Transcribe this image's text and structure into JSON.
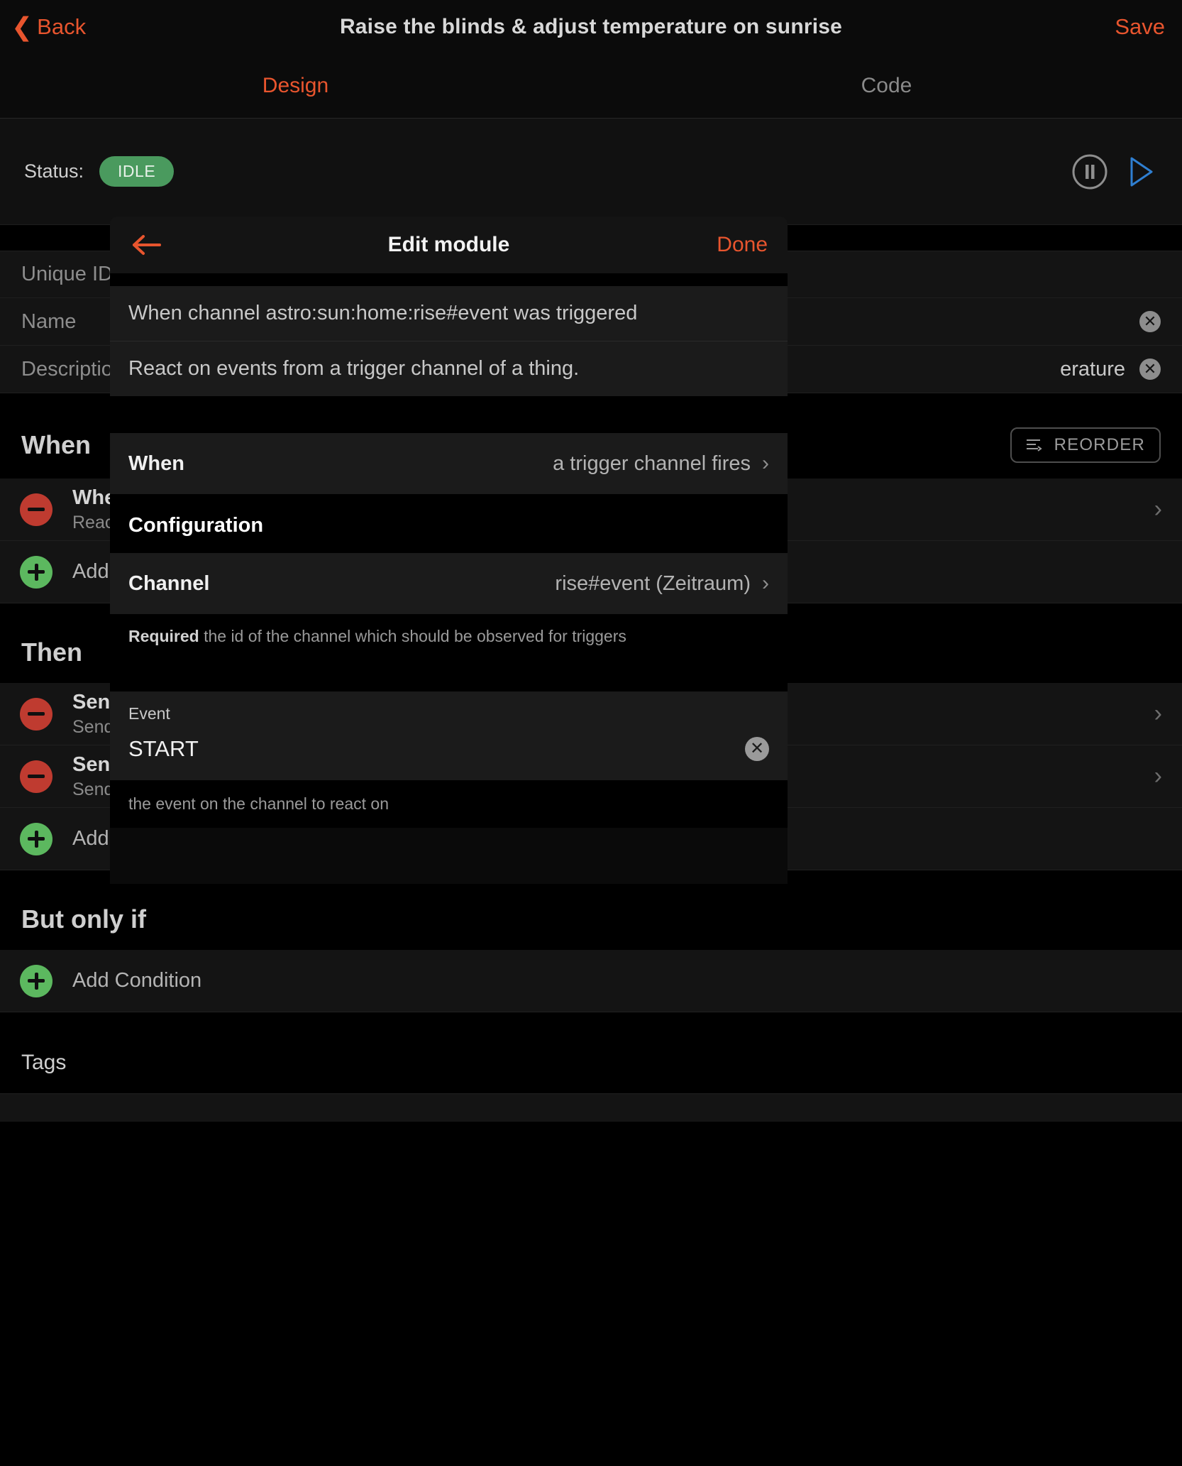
{
  "navbar": {
    "back_label": "Back",
    "title": "Raise the blinds & adjust temperature on sunrise",
    "save_label": "Save"
  },
  "tabs": [
    {
      "label": "Design",
      "state": "active"
    },
    {
      "label": "Code",
      "state": "inactive"
    }
  ],
  "status": {
    "label": "Status:",
    "badge": "IDLE",
    "badge_color": "#4a9a5e",
    "pause_icon": "pause-circle-icon",
    "play_icon": "play-icon"
  },
  "form": {
    "rows": [
      {
        "label": "Unique ID",
        "value": "",
        "has_clear": false
      },
      {
        "label": "Name",
        "value": "",
        "has_clear": true
      },
      {
        "label": "Description",
        "value": "erature",
        "has_clear": true
      }
    ]
  },
  "sections": {
    "when": {
      "title": "When",
      "reorder_label": "REORDER",
      "rows": [
        {
          "type": "remove",
          "title": "When",
          "sub": "React o",
          "chevron": "›"
        },
        {
          "type": "add",
          "title": "Add Tr"
        }
      ]
    },
    "then": {
      "title": "Then",
      "rows": [
        {
          "type": "remove",
          "title": "Send",
          "sub": "Sends a",
          "chevron": "›"
        },
        {
          "type": "remove",
          "title": "Send",
          "sub": "Sends a",
          "chevron": "›"
        },
        {
          "type": "add",
          "title": "Add A"
        }
      ]
    },
    "but_only_if": {
      "title": "But only if",
      "rows": [
        {
          "type": "add",
          "title": "Add Condition"
        }
      ]
    },
    "tags": {
      "title": "Tags"
    }
  },
  "modal": {
    "back_icon": "arrow-left-icon",
    "title": "Edit module",
    "done_label": "Done",
    "summary": "When channel astro:sun:home:rise#event was triggered",
    "description": "React on events from a trigger channel of a thing.",
    "when_row": {
      "key": "When",
      "value": "a trigger channel fires",
      "chevron": "›"
    },
    "configuration_title": "Configuration",
    "channel_row": {
      "key": "Channel",
      "value": "rise#event (Zeitraum)",
      "chevron": "›"
    },
    "channel_help_strong": "Required",
    "channel_help": " the id of the channel which should be observed for triggers",
    "event_field": {
      "label": "Event",
      "value": "START",
      "clear_icon": "clear-circle-icon",
      "help": "the event on the channel to react on"
    }
  },
  "colors": {
    "accent": "#e8552e",
    "ok_green": "#5cb85f",
    "danger_red": "#bf3b30",
    "play_blue": "#2f7fd1"
  }
}
